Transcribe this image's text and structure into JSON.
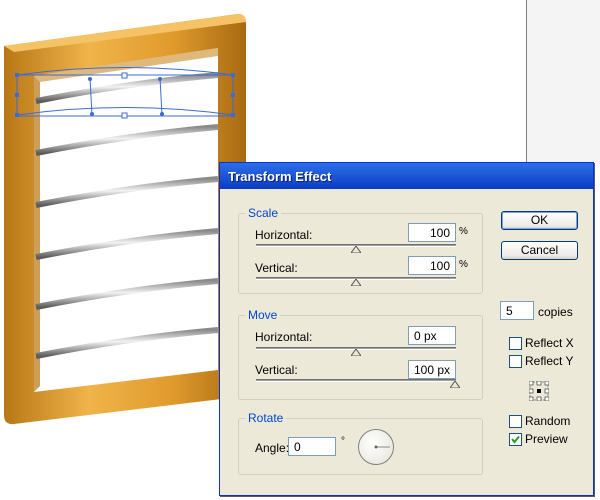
{
  "dialog": {
    "title": "Transform Effect",
    "scale": {
      "legend": "Scale",
      "horizontal_label": "Horizontal:",
      "horizontal_value": "100",
      "horizontal_unit": "%",
      "vertical_label": "Vertical:",
      "vertical_value": "100",
      "vertical_unit": "%"
    },
    "move": {
      "legend": "Move",
      "horizontal_label": "Horizontal:",
      "horizontal_value": "0 px",
      "vertical_label": "Vertical:",
      "vertical_value": "100 px"
    },
    "rotate": {
      "legend": "Rotate",
      "angle_label": "Angle:",
      "angle_value": "0",
      "angle_unit": "°"
    },
    "ok_label": "OK",
    "cancel_label": "Cancel",
    "copies_value": "5",
    "copies_label": "copies",
    "reflect_x_label": "Reflect X",
    "reflect_x_checked": false,
    "reflect_y_label": "Reflect Y",
    "reflect_y_checked": false,
    "random_label": "Random",
    "random_checked": false,
    "preview_label": "Preview",
    "preview_checked": true
  },
  "colors": {
    "frame": "#e5a43b",
    "title_bar": "#1f58d8",
    "selection": "#3b6bd6"
  }
}
